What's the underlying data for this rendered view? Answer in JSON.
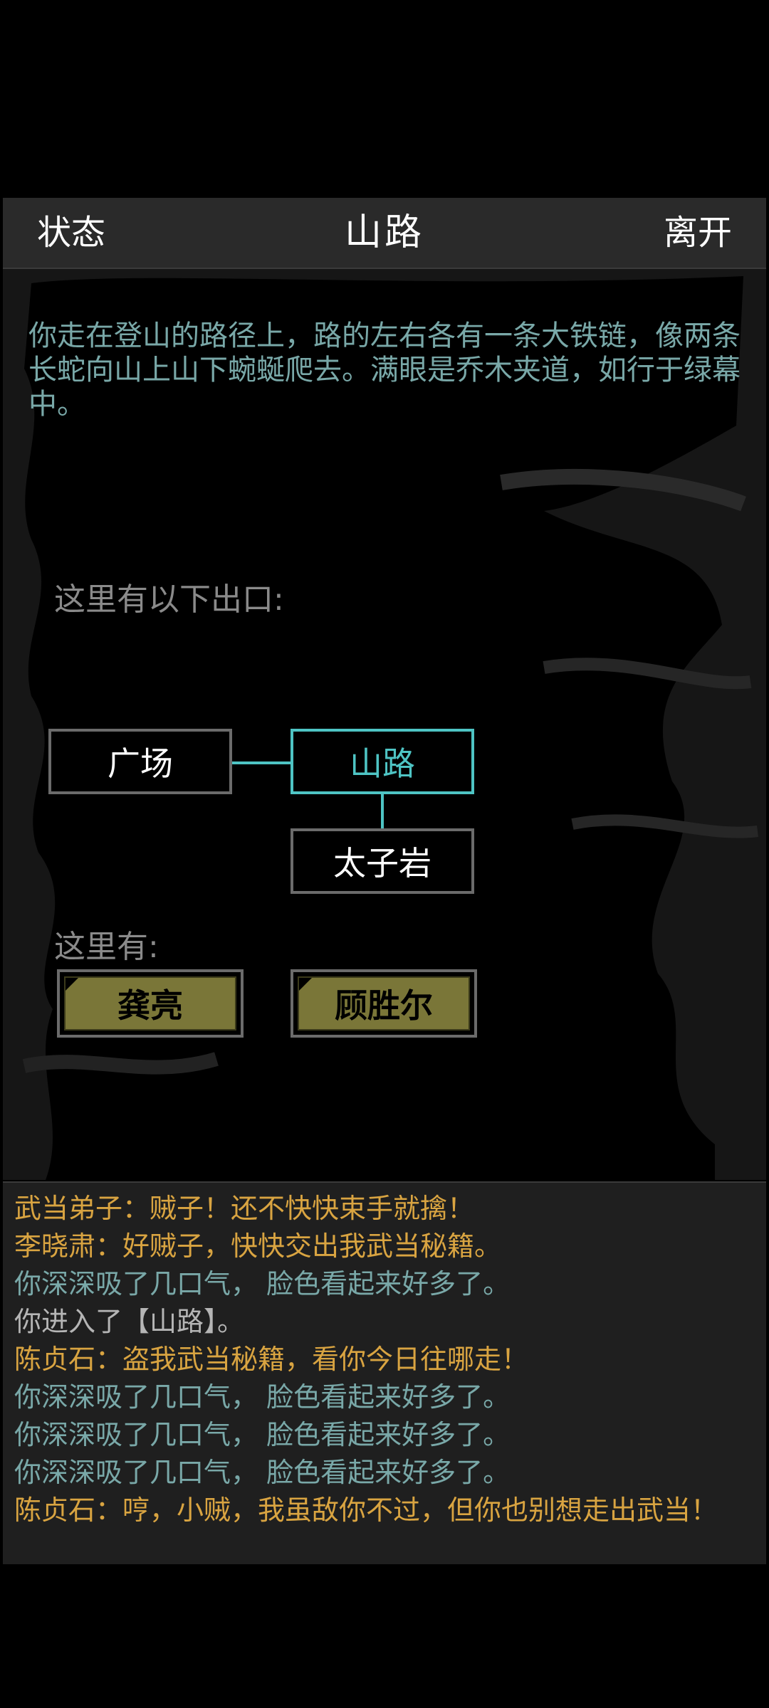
{
  "header": {
    "left_label": "状态",
    "title": "山路",
    "right_label": "离开"
  },
  "scene": {
    "description": "你走在登山的路径上，路的左右各有一条大铁链，像两条长蛇向山上山下蜿蜒爬去。满眼是乔木夹道，如行于绿幕中。",
    "exits_label": "这里有以下出口:",
    "rooms": {
      "west": "广场",
      "current": "山路",
      "south": "太子岩"
    },
    "here_label": "这里有:",
    "npcs": [
      "龚亮",
      "顾胜尔"
    ]
  },
  "log": [
    {
      "text": "武当弟子：贼子！还不快快束手就擒！",
      "color": "yellow"
    },
    {
      "text": "李晓肃：好贼子，快快交出我武当秘籍。",
      "color": "yellow"
    },
    {
      "text": "你深深吸了几口气， 脸色看起来好多了。",
      "color": "cyan"
    },
    {
      "text": "你进入了【山路】。",
      "color": "gray"
    },
    {
      "text": "陈贞石：盗我武当秘籍，看你今日往哪走！",
      "color": "yellow"
    },
    {
      "text": "你深深吸了几口气， 脸色看起来好多了。",
      "color": "cyan"
    },
    {
      "text": "你深深吸了几口气， 脸色看起来好多了。",
      "color": "cyan"
    },
    {
      "text": "你深深吸了几口气， 脸色看起来好多了。",
      "color": "cyan"
    },
    {
      "text": "陈贞石：哼，小贼，我虽敌你不过，但你也别想走出武当！",
      "color": "yellow"
    }
  ],
  "colors": {
    "accent": "#4ec4c4",
    "npc_fill": "#7a7638",
    "log_yellow": "#d9a441",
    "log_cyan": "#79a8a8"
  }
}
